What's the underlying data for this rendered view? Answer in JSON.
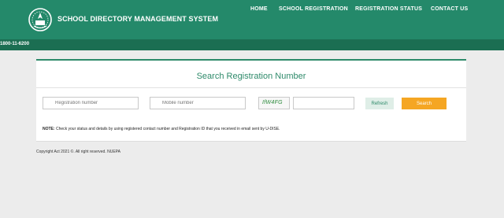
{
  "header": {
    "title": "SCHOOL DIRECTORY MANAGEMENT SYSTEM",
    "nav": [
      "HOME",
      "SCHOOL REGISTRATION",
      "REGISTRATION STATUS",
      "CONTACT US"
    ]
  },
  "helpline": "1800-11-6200",
  "search_panel": {
    "title": "Search Registration Number",
    "registration_placeholder": "Registration number",
    "mobile_placeholder": "Mobile number",
    "captcha_text": "IfW4FG",
    "captcha_value": "",
    "refresh_label": "Refresh",
    "search_label": "Search",
    "note_label": "NOTE:",
    "note_text": " Check your status and details by using registered contact number and Registration ID that you received in email sent by U-DISE."
  },
  "footer": {
    "copyright": "Copyright Act 2021 ©. All right reserved. NUEPA"
  },
  "colors": {
    "header": "#24896a",
    "subbar": "#1b6e52",
    "accent": "#2e8a6a",
    "search_button": "#f5a623"
  },
  "icons": [
    "emblem-logo",
    "search-icon",
    "phone-icon"
  ]
}
